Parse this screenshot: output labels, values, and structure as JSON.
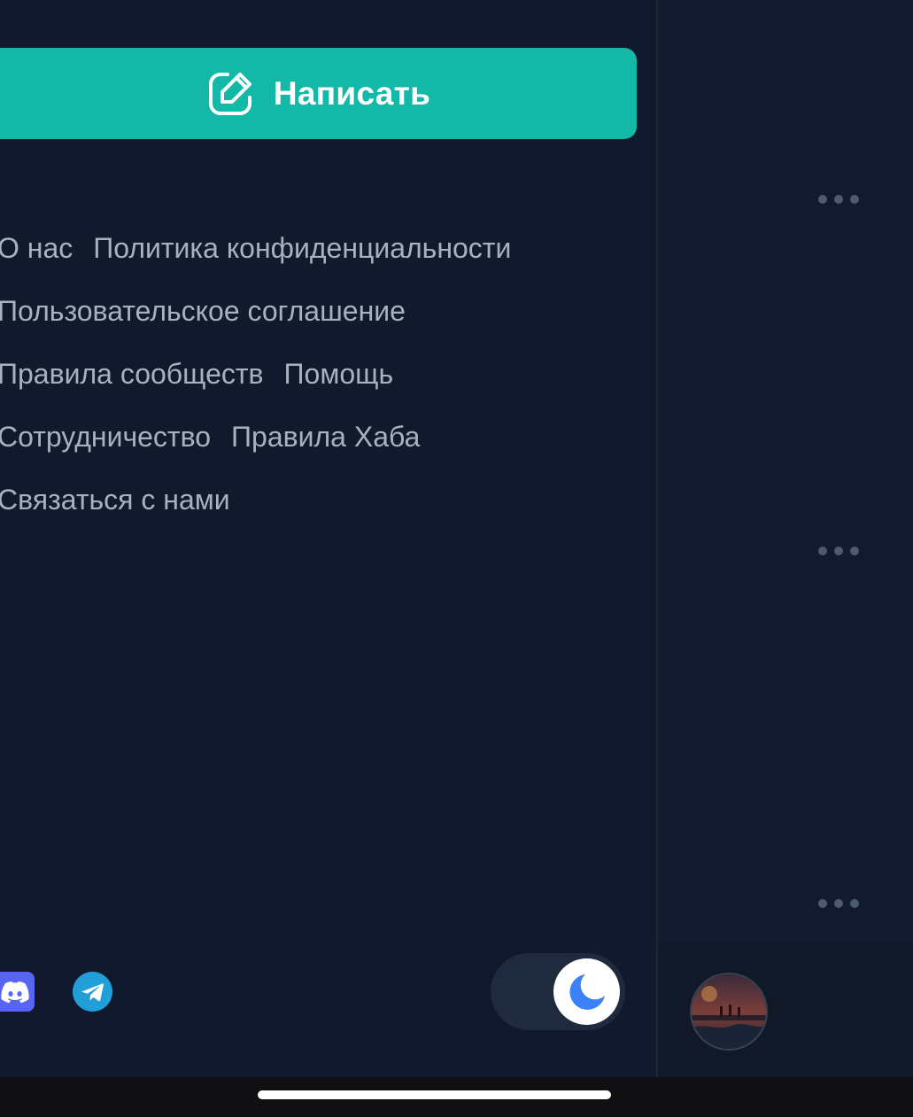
{
  "drawer": {
    "write_button": {
      "label": "Написать",
      "icon": "pencil-square-icon"
    },
    "links": [
      [
        "О нас",
        "Политика конфиденциальности"
      ],
      [
        "Пользовательское соглашение"
      ],
      [
        "Правила сообществ",
        "Помощь"
      ],
      [
        "Сотрудничество",
        "Правила Хаба"
      ],
      [
        "Связаться с нами"
      ]
    ],
    "social": {
      "discord_icon": "discord-icon",
      "telegram_icon": "telegram-icon"
    },
    "theme_toggle": {
      "state": "dark",
      "icon": "moon-icon"
    }
  },
  "colors": {
    "background": "#111a2c",
    "accent": "#14b8a6",
    "link_text": "#a7b1c2",
    "toggle_moon": "#3b82f6"
  },
  "right_panel": {
    "more_icons": [
      "more-dots-icon",
      "more-dots-icon",
      "more-dots-icon"
    ]
  }
}
